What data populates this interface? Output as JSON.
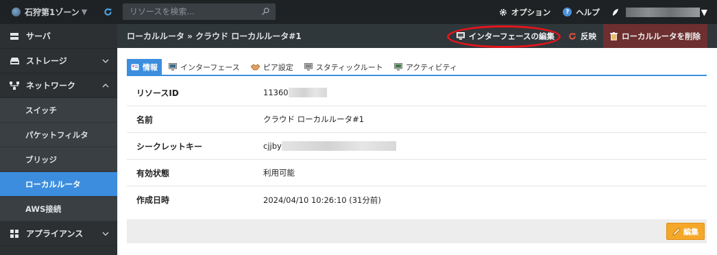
{
  "topbar": {
    "zone_label": "石狩第1ゾーン",
    "search_placeholder": "リソースを検索...",
    "options_label": "オプション",
    "help_label": "ヘルプ"
  },
  "sidebar": {
    "items": [
      {
        "label": "サーバ",
        "icon": "server-icon"
      },
      {
        "label": "ストレージ",
        "icon": "storage-icon"
      },
      {
        "label": "ネットワーク",
        "icon": "network-icon"
      },
      {
        "label": "アプライアンス",
        "icon": "grid-icon"
      }
    ],
    "network_sub": [
      "スイッチ",
      "パケットフィルタ",
      "ブリッジ",
      "ローカルルータ",
      "AWS接続"
    ],
    "active_sub": "ローカルルータ"
  },
  "header": {
    "breadcrumb": "ローカルルータ » クラウド ローカルルータ#1",
    "edit_interface_label": "インターフェースの編集",
    "apply_label": "反映",
    "delete_label": "ローカルルータを削除"
  },
  "tabs": [
    "情報",
    "インターフェース",
    "ピア設定",
    "スタティックルート",
    "アクティビティ"
  ],
  "active_tab": "情報",
  "details": {
    "rows": [
      {
        "key": "リソースID",
        "value": "11360"
      },
      {
        "key": "名前",
        "value": "クラウド ローカルルータ#1"
      },
      {
        "key": "シークレットキー",
        "value": "cjjby"
      },
      {
        "key": "有効状態",
        "value": "利用可能"
      },
      {
        "key": "作成日時",
        "value": "2024/04/10 10:26:10 (31分前)"
      }
    ]
  },
  "footer": {
    "edit_label": "編集"
  },
  "colors": {
    "accent": "#3c8dde",
    "annotation": "#e8141b",
    "edit_button": "#f5a72a",
    "danger": "#6d2f2f"
  }
}
